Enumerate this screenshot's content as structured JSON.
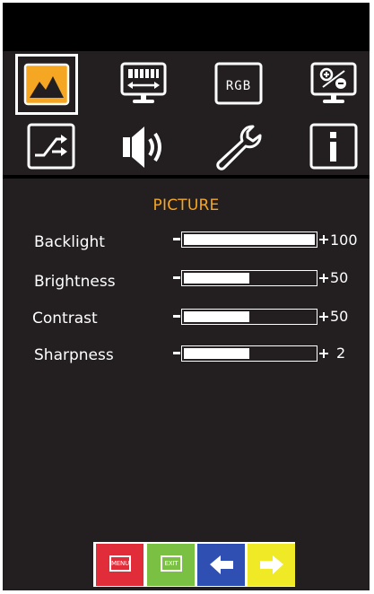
{
  "menu": {
    "section_title": "PICTURE",
    "tabs": [
      {
        "id": "picture",
        "icon": "picture-icon",
        "selected": true
      },
      {
        "id": "display",
        "icon": "monitor-icon",
        "selected": false
      },
      {
        "id": "color",
        "icon": "rgb-icon",
        "label": "RGB",
        "selected": false
      },
      {
        "id": "ratio",
        "icon": "percent-monitor-icon",
        "selected": false
      },
      {
        "id": "input",
        "icon": "input-switch-icon",
        "selected": false
      },
      {
        "id": "audio",
        "icon": "speaker-icon",
        "selected": false
      },
      {
        "id": "setup",
        "icon": "wrench-icon",
        "selected": false
      },
      {
        "id": "info",
        "icon": "info-icon",
        "selected": false
      }
    ],
    "settings": [
      {
        "label": "Backlight",
        "value": "100",
        "level": 1.0
      },
      {
        "label": "Brightness",
        "value": "50",
        "level": 0.5
      },
      {
        "label": "Contrast",
        "value": "50",
        "level": 0.5
      },
      {
        "label": "Sharpness",
        "value": "2",
        "level": 0.5
      }
    ]
  },
  "buttons": {
    "menu_label": "MENU",
    "exit_label": "EXIT",
    "menu_color": "#e12d39",
    "exit_color": "#7ac143",
    "left_color": "#2f4fb3",
    "right_color": "#f0e926"
  },
  "colors": {
    "accent": "#f5a623",
    "panel": "#231f20"
  }
}
